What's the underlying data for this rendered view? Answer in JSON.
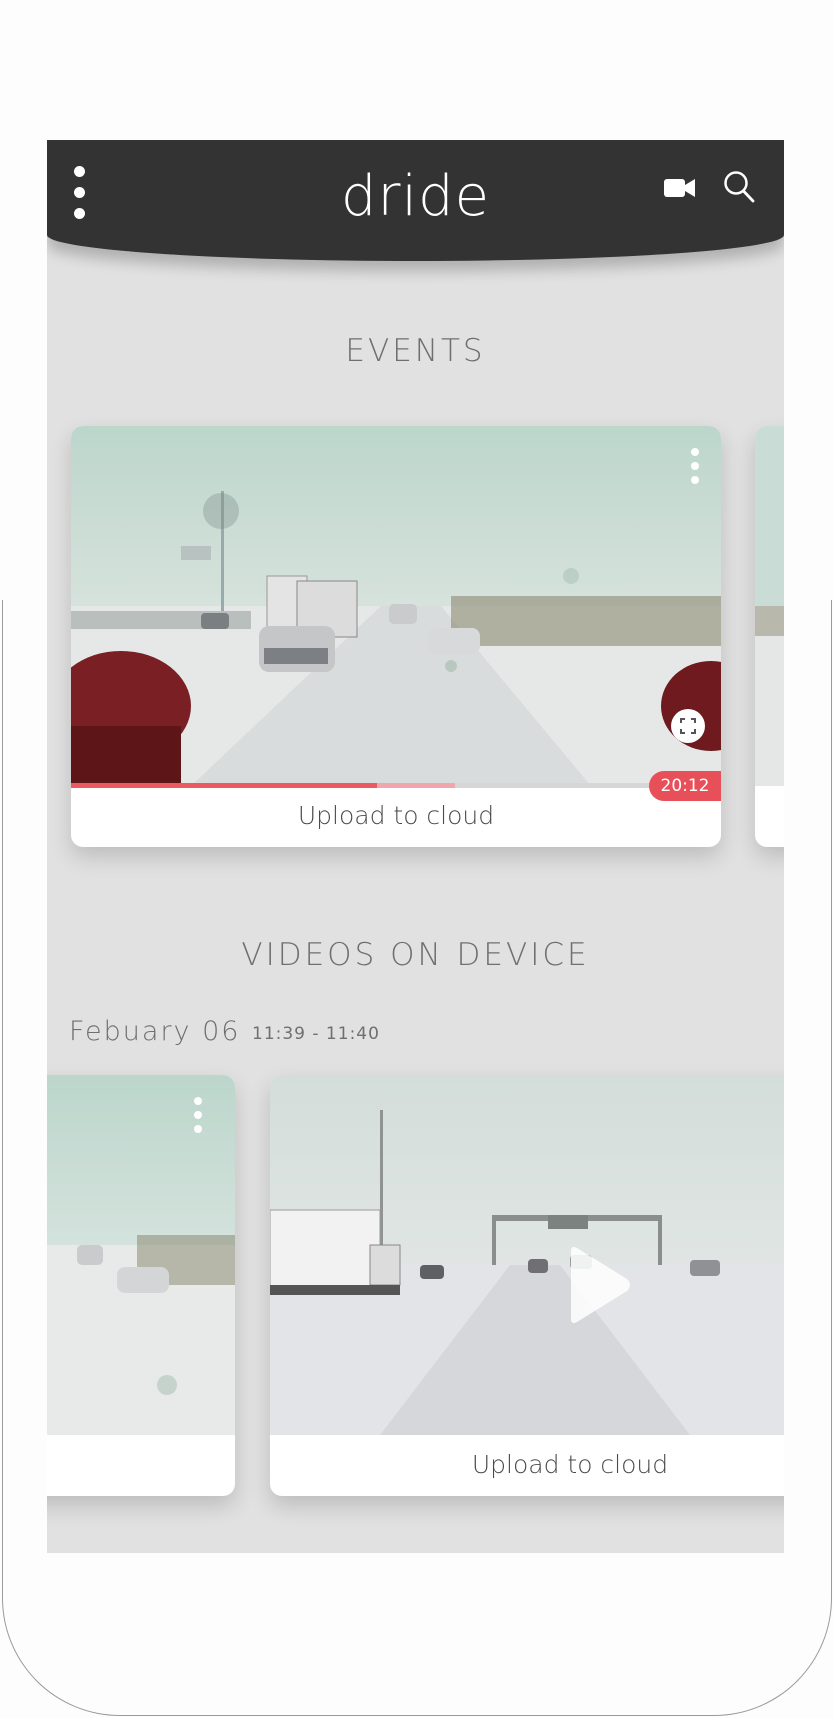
{
  "app": {
    "logo_text": "dride"
  },
  "header": {
    "menu_icon": "kebab-menu-icon",
    "camera_icon": "video-camera-icon",
    "search_icon": "search-icon"
  },
  "events": {
    "title": "EVENTS",
    "card": {
      "label": "Upload to cloud",
      "duration": "20:12",
      "progress_played": 0.47,
      "progress_buffered": 0.59,
      "thumbnail": "snowy-highway-dashcam"
    }
  },
  "videos_on_device": {
    "title": "VIDEOS ON DEVICE",
    "group": {
      "date": "Febuary 06",
      "time_range": "11:39 - 11:40"
    },
    "cards": [
      {
        "label": "",
        "thumbnail": "snowy-highway-dashcam"
      },
      {
        "label": "Upload to cloud",
        "thumbnail": "snowy-highway-truck-dashcam"
      }
    ]
  },
  "colors": {
    "header_bg": "#333333",
    "screen_bg": "#e1e1e1",
    "accent": "#e85059",
    "text": "#6f6f6f"
  }
}
